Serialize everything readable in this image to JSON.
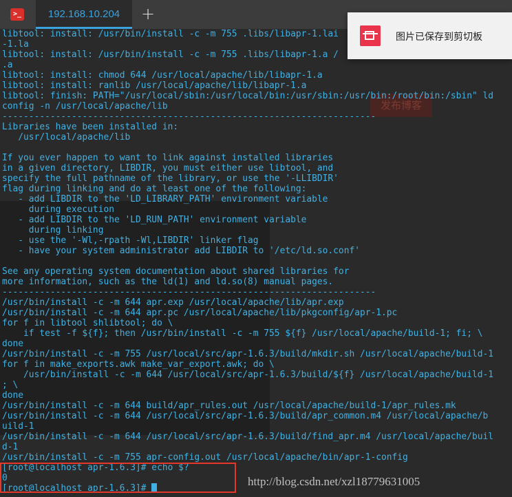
{
  "window": {
    "app_icon_glyph": ">_",
    "tab_title": "192.168.10.204",
    "new_tab_glyph": "+"
  },
  "background": {
    "ghost_button": "发布博客"
  },
  "terminal": {
    "lines": [
      "libtool: install: /usr/bin/install -c -m 755 .libs/libapr-1.lai",
      "-1.la",
      "libtool: install: /usr/bin/install -c -m 755 .libs/libapr-1.a /",
      ".a",
      "libtool: install: chmod 644 /usr/local/apache/lib/libapr-1.a",
      "libtool: install: ranlib /usr/local/apache/lib/libapr-1.a",
      "libtool: finish: PATH=\"/usr/local/sbin:/usr/local/bin:/usr/sbin:/usr/bin:/root/bin:/sbin\" ld",
      "config -n /usr/local/apache/lib",
      "----------------------------------------------------------------------",
      "Libraries have been installed in:",
      "   /usr/local/apache/lib",
      "",
      "If you ever happen to want to link against installed libraries",
      "in a given directory, LIBDIR, you must either use libtool, and",
      "specify the full pathname of the library, or use the '-LLIBDIR'",
      "flag during linking and do at least one of the following:",
      "   - add LIBDIR to the 'LD_LIBRARY_PATH' environment variable",
      "     during execution",
      "   - add LIBDIR to the 'LD_RUN_PATH' environment variable",
      "     during linking",
      "   - use the '-Wl,-rpath -Wl,LIBDIR' linker flag",
      "   - have your system administrator add LIBDIR to '/etc/ld.so.conf'",
      "",
      "See any operating system documentation about shared libraries for",
      "more information, such as the ld(1) and ld.so(8) manual pages.",
      "----------------------------------------------------------------------",
      "/usr/bin/install -c -m 644 apr.exp /usr/local/apache/lib/apr.exp",
      "/usr/bin/install -c -m 644 apr.pc /usr/local/apache/lib/pkgconfig/apr-1.pc",
      "for f in libtool shlibtool; do \\",
      "    if test -f ${f}; then /usr/bin/install -c -m 755 ${f} /usr/local/apache/build-1; fi; \\",
      "done",
      "/usr/bin/install -c -m 755 /usr/local/src/apr-1.6.3/build/mkdir.sh /usr/local/apache/build-1",
      "for f in make_exports.awk make_var_export.awk; do \\",
      "    /usr/bin/install -c -m 644 /usr/local/src/apr-1.6.3/build/${f} /usr/local/apache/build-1",
      "; \\",
      "done",
      "/usr/bin/install -c -m 644 build/apr_rules.out /usr/local/apache/build-1/apr_rules.mk",
      "/usr/bin/install -c -m 644 /usr/local/src/apr-1.6.3/build/apr_common.m4 /usr/local/apache/b",
      "uild-1",
      "/usr/bin/install -c -m 644 /usr/local/src/apr-1.6.3/build/find_apr.m4 /usr/local/apache/buil",
      "d-1",
      "/usr/bin/install -c -m 755 apr-config.out /usr/local/apache/bin/apr-1-config",
      "[root@localhost apr-1.6.3]# echo $?",
      "0",
      "[root@localhost apr-1.6.3]# "
    ],
    "finish_path_text": "PATH=\"/usr/local/sbin:/usr/local/bin:/usr/sbin:/usr/bin:/root/bin:/sbin\""
  },
  "toast": {
    "icon": "crop-icon",
    "text": "图片已保存到剪切板"
  },
  "watermark": "http://blog.csdn.net/xzl18779631005",
  "colors": {
    "terminal_text": "#41b1e3",
    "tab_accent": "#3aa2df",
    "highlight_border": "#e5382b",
    "toast_icon": "#e8354c"
  }
}
